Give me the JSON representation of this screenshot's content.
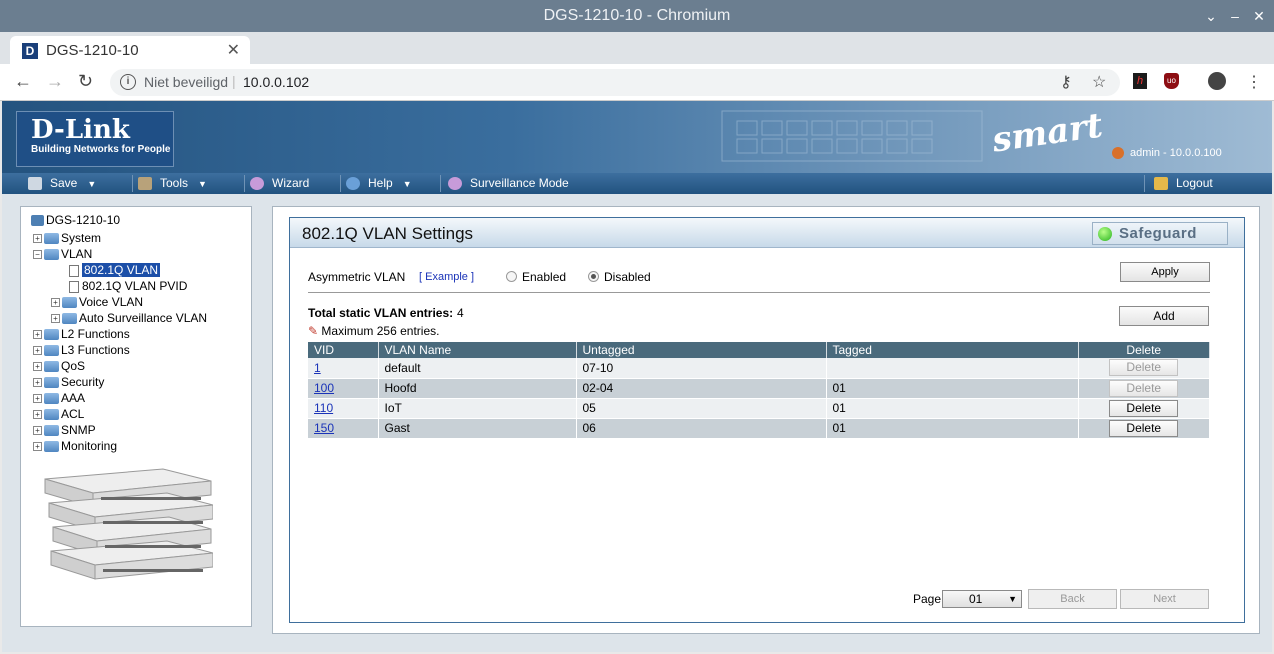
{
  "window": {
    "title": "DGS-1210-10 - Chromium"
  },
  "tab": {
    "favicon": "D",
    "title": "DGS-1210-10"
  },
  "address": {
    "security": "Niet beveiligd",
    "url": "10.0.0.102"
  },
  "banner": {
    "brand": "D-Link",
    "tagline": "Building Networks for People",
    "product_badge": "smart",
    "user": "admin - 10.0.0.100"
  },
  "menu": {
    "save": "Save",
    "tools": "Tools",
    "wizard": "Wizard",
    "help": "Help",
    "surveillance": "Surveillance Mode",
    "logout": "Logout"
  },
  "tree": {
    "root": "DGS-1210-10",
    "items": [
      "System",
      "VLAN",
      "802.1Q VLAN",
      "802.1Q VLAN PVID",
      "Voice VLAN",
      "Auto Surveillance VLAN",
      "L2 Functions",
      "L3 Functions",
      "QoS",
      "Security",
      "AAA",
      "ACL",
      "SNMP",
      "Monitoring"
    ]
  },
  "panel": {
    "title": "802.1Q VLAN Settings",
    "safeguard": "Safeguard",
    "asym_label": "Asymmetric VLAN",
    "example_link": "[ Example ]",
    "enabled": "Enabled",
    "disabled": "Disabled",
    "asym_selected": "Disabled",
    "apply": "Apply",
    "total_label": "Total static VLAN entries:",
    "total_value": "4",
    "max_note": "Maximum 256 entries.",
    "add": "Add",
    "columns": [
      "VID",
      "VLAN Name",
      "Untagged",
      "Tagged",
      "Delete"
    ],
    "rows": [
      {
        "vid": "1",
        "name": "default",
        "untagged": "07-10",
        "tagged": "",
        "delete": "Delete",
        "delete_enabled": false
      },
      {
        "vid": "100",
        "name": "Hoofd",
        "untagged": "02-04",
        "tagged": "01",
        "delete": "Delete",
        "delete_enabled": false
      },
      {
        "vid": "110",
        "name": "IoT",
        "untagged": "05",
        "tagged": "01",
        "delete": "Delete",
        "delete_enabled": true
      },
      {
        "vid": "150",
        "name": "Gast",
        "untagged": "06",
        "tagged": "01",
        "delete": "Delete",
        "delete_enabled": true
      }
    ],
    "page_label": "Page",
    "page_value": "01",
    "back": "Back",
    "next": "Next"
  },
  "colors": {
    "titlebar": "#6b7e90",
    "menubar": "#2c5f8f",
    "table_header": "#4a6a7c",
    "link": "#1a33b8",
    "safeguard_led": "#26b31c"
  }
}
